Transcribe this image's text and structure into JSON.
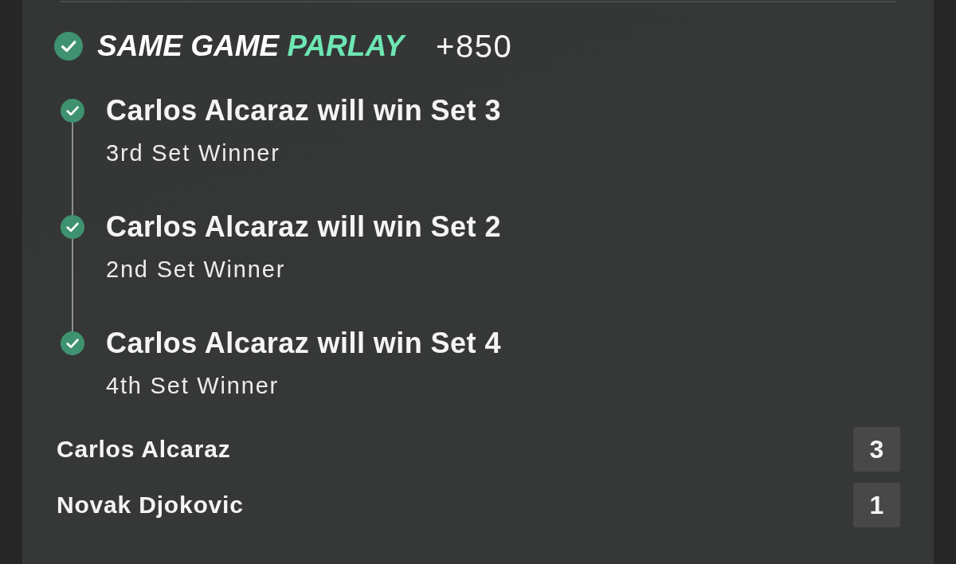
{
  "bet": {
    "won": true,
    "title": {
      "main": "SAME GAME",
      "accent": "PARLAY"
    },
    "odds": "+850"
  },
  "legs": [
    {
      "selection": "Carlos Alcaraz will win Set 3",
      "market": "3rd Set Winner",
      "won": true
    },
    {
      "selection": "Carlos Alcaraz will win Set 2",
      "market": "2nd Set Winner",
      "won": true
    },
    {
      "selection": "Carlos Alcaraz will win Set 4",
      "market": "4th Set Winner",
      "won": true
    }
  ],
  "scoreboard": [
    {
      "player": "Carlos Alcaraz",
      "score": "3"
    },
    {
      "player": "Novak Djokovic",
      "score": "1"
    }
  ]
}
